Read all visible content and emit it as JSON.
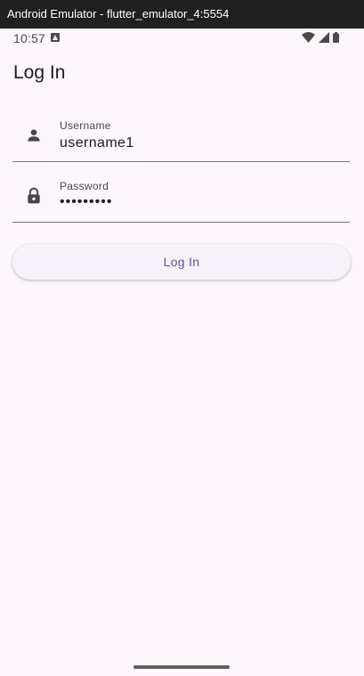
{
  "window": {
    "title": "Android Emulator - flutter_emulator_4:5554"
  },
  "status_bar": {
    "time": "10:57",
    "notification_icon": "font-a-icon",
    "icons": [
      "wifi-icon",
      "signal-icon",
      "battery-icon"
    ]
  },
  "app": {
    "title": "Log In"
  },
  "form": {
    "username": {
      "label": "Username",
      "value": "username1",
      "icon": "person-icon"
    },
    "password": {
      "label": "Password",
      "value": "•••••••••",
      "icon": "lock-icon"
    },
    "submit_label": "Log In"
  },
  "colors": {
    "background": "#fdf6fd",
    "primary": "#6750a4",
    "on_surface": "#1c1b1f",
    "outline": "#79747e",
    "button_surface": "#f7f2fa"
  }
}
